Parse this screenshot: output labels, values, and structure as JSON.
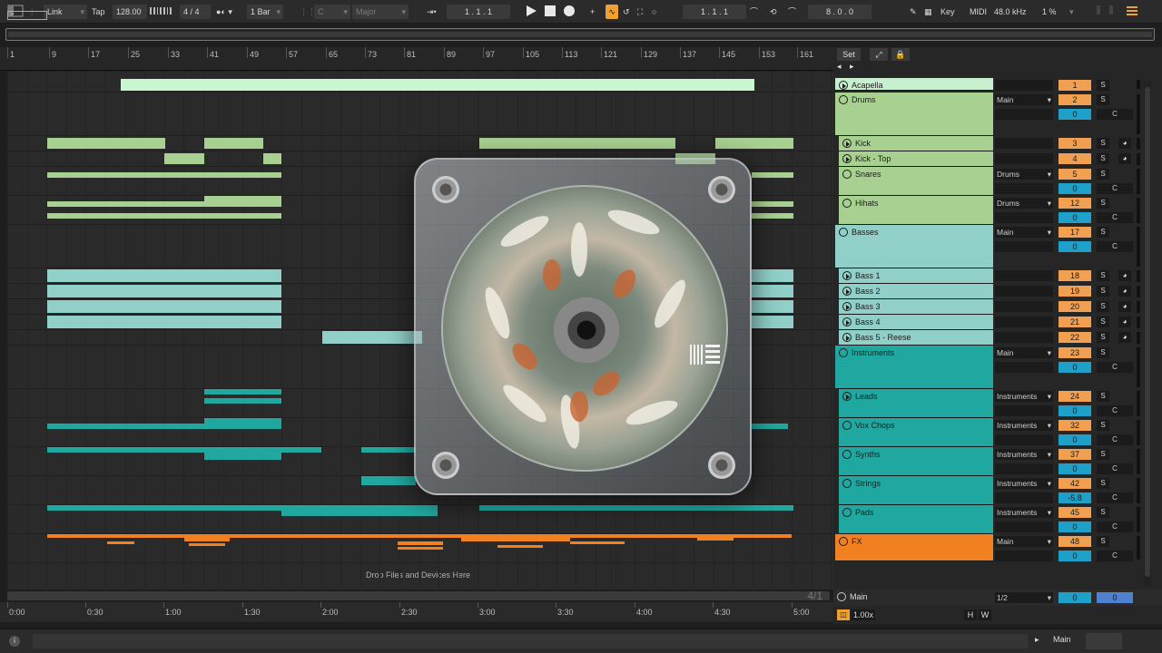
{
  "transport": {
    "link": "Link",
    "tap": "Tap",
    "tempo": "128.00",
    "signature": "4 / 4",
    "quant": "1 Bar",
    "key": "C",
    "scale": "Major",
    "position": "1 . 1 . 1",
    "loop_start": "1 . 1 . 1",
    "loop_length": "8 . 0 . 0",
    "key_label": "Key",
    "midi_label": "MIDI",
    "sample_rate": "48.0 kHz",
    "cpu": "1 %"
  },
  "ruler": {
    "bars": [
      "1",
      "9",
      "17",
      "25",
      "33",
      "41",
      "49",
      "57",
      "65",
      "73",
      "81",
      "89",
      "97",
      "105",
      "113",
      "121",
      "129",
      "137",
      "145",
      "153",
      "161"
    ]
  },
  "timeline": {
    "labels": [
      "0:00",
      "0:30",
      "1:00",
      "1:30",
      "2:00",
      "2:30",
      "3:00",
      "3:30",
      "4:00",
      "4:30",
      "5:00"
    ],
    "position_marker": "4/1"
  },
  "arrangement": {
    "drop_hint": "Drop Files and Devices Here"
  },
  "panel": {
    "set_label": "Set"
  },
  "tracks": [
    {
      "name": "Acapella",
      "num": "1",
      "color": "#c8f0d0"
    },
    {
      "name": "Drums",
      "num": "2",
      "route": "Main",
      "vol": "0",
      "color": "#a8d090"
    },
    {
      "name": "Kick",
      "num": "3",
      "color": "#a8d090"
    },
    {
      "name": "Kick - Top",
      "num": "4",
      "color": "#a8d090"
    },
    {
      "name": "Snares",
      "num": "5",
      "route": "Drums",
      "vol": "0",
      "color": "#a8d090"
    },
    {
      "name": "Hihats",
      "num": "12",
      "route": "Drums",
      "vol": "0",
      "color": "#a8d090"
    },
    {
      "name": "Basses",
      "num": "17",
      "route": "Main",
      "vol": "0",
      "color": "#90d0c8"
    },
    {
      "name": "Bass 1",
      "num": "18",
      "color": "#90d0c8"
    },
    {
      "name": "Bass 2",
      "num": "19",
      "color": "#90d0c8"
    },
    {
      "name": "Bass 3",
      "num": "20",
      "color": "#90d0c8"
    },
    {
      "name": "Bass 4",
      "num": "21",
      "color": "#90d0c8"
    },
    {
      "name": "Bass 5 - Reese",
      "num": "22",
      "color": "#90d0c8"
    },
    {
      "name": "Instruments",
      "num": "23",
      "route": "Main",
      "vol": "0",
      "color": "#20a8a0"
    },
    {
      "name": "Leads",
      "num": "24",
      "route": "Instruments",
      "vol": "0",
      "color": "#20a8a0"
    },
    {
      "name": "Vox Chops",
      "num": "32",
      "route": "Instruments",
      "vol": "0",
      "color": "#20a8a0"
    },
    {
      "name": "Synths",
      "num": "37",
      "route": "Instruments",
      "vol": "0",
      "color": "#20a8a0"
    },
    {
      "name": "Strings",
      "num": "42",
      "route": "Instruments",
      "vol": "-5.8",
      "color": "#20a8a0"
    },
    {
      "name": "Pads",
      "num": "45",
      "route": "Instruments",
      "vol": "0",
      "color": "#20a8a0"
    },
    {
      "name": "FX",
      "num": "48",
      "route": "Main",
      "vol": "0",
      "color": "#f08020"
    }
  ],
  "main_track": {
    "name": "Main",
    "route": "1/2",
    "vol": "0",
    "h": "H",
    "w": "W",
    "speed": "1.00x"
  },
  "buttons": {
    "solo": "S",
    "cue": "C"
  },
  "statusbar": {
    "main": "Main"
  }
}
